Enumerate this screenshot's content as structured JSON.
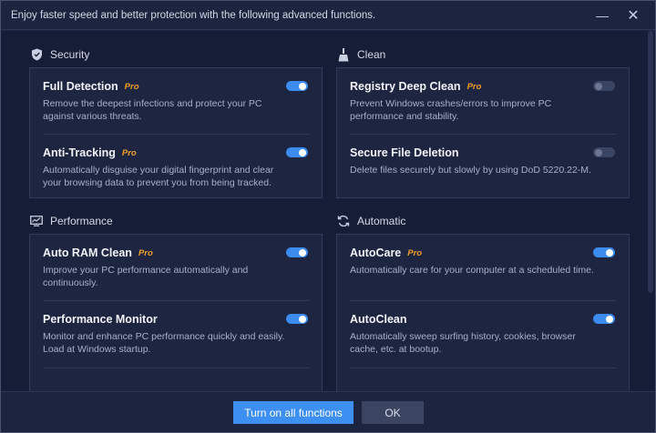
{
  "titlebar": {
    "title": "Enjoy faster speed and better protection with the following advanced functions.",
    "minimize_glyph": "—",
    "close_glyph": "✕"
  },
  "sections": {
    "security": {
      "label": "Security",
      "icon": "shield-icon",
      "items": [
        {
          "title": "Full Detection",
          "pro": "Pro",
          "desc": "Remove the deepest infections and protect your PC against various threats.",
          "enabled": true
        },
        {
          "title": "Anti-Tracking",
          "pro": "Pro",
          "desc": "Automatically disguise your digital fingerprint and clear your browsing data to prevent you from being tracked.",
          "enabled": true
        }
      ]
    },
    "clean": {
      "label": "Clean",
      "icon": "broom-icon",
      "items": [
        {
          "title": "Registry Deep Clean",
          "pro": "Pro",
          "desc": "Prevent Windows crashes/errors to improve PC performance and stability.",
          "enabled": false
        },
        {
          "title": "Secure File Deletion",
          "pro": "",
          "desc": "Delete files securely but slowly by using DoD 5220.22-M.",
          "enabled": false
        }
      ]
    },
    "performance": {
      "label": "Performance",
      "icon": "monitor-chart-icon",
      "items": [
        {
          "title": "Auto RAM Clean",
          "pro": "Pro",
          "desc": "Improve your PC performance automatically and continuously.",
          "enabled": true
        },
        {
          "title": "Performance Monitor",
          "pro": "",
          "desc": "Monitor and enhance PC performance quickly and easily. Load at Windows startup.",
          "enabled": true
        }
      ]
    },
    "automatic": {
      "label": "Automatic",
      "icon": "refresh-icon",
      "items": [
        {
          "title": "AutoCare",
          "pro": "Pro",
          "desc": "Automatically care for your computer at a scheduled time.",
          "enabled": true
        },
        {
          "title": "AutoClean",
          "pro": "",
          "desc": "Automatically sweep surfing history, cookies, browser cache, etc. at bootup.",
          "enabled": true
        }
      ]
    }
  },
  "footer": {
    "primary_label": "Turn on all functions",
    "secondary_label": "OK"
  },
  "colors": {
    "accent": "#3d8ff2",
    "pro": "#f0a027",
    "background": "#1c2440"
  }
}
